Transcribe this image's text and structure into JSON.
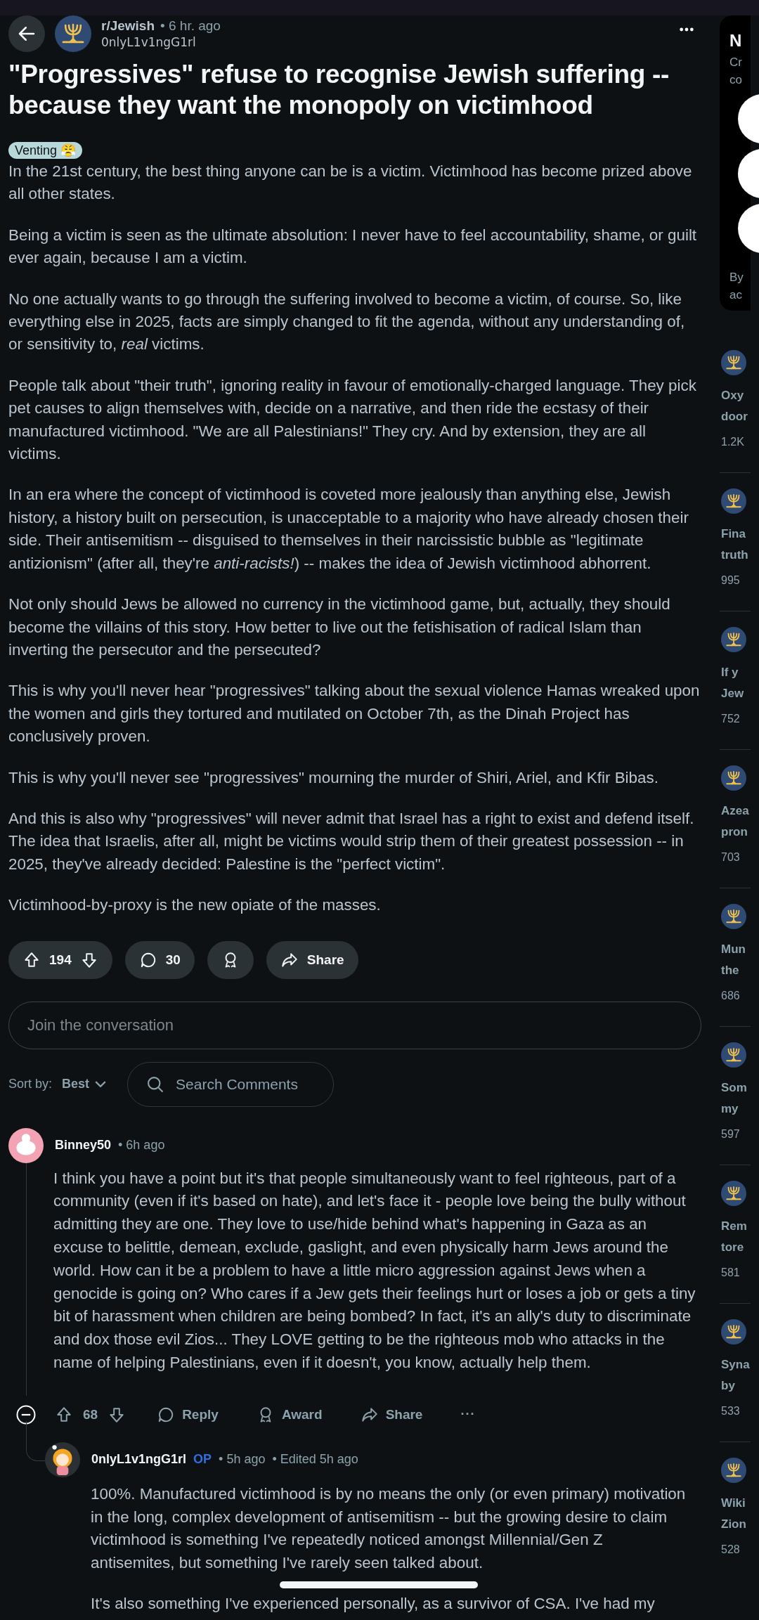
{
  "post": {
    "subreddit": "r/Jewish",
    "time": "• 6 hr. ago",
    "author": "0nlyL1v1ngG1rl",
    "title": "\"Progressives\" refuse to recognise Jewish suffering -- because they want the monopoly on victimhood",
    "flair": "Venting 😤",
    "paragraphs": [
      "In the 21st century, the best thing anyone can be is a victim. Victimhood has become prized above all other states.",
      "Being a victim is seen as the ultimate absolution: I never have to feel accountability, shame, or guilt ever again, because I am a victim.",
      "No one actually wants to go through the suffering involved to become a victim, of course. So, like everything else in 2025, facts are simply changed to fit the agenda, without any understanding of, or sensitivity to, *real* victims.",
      "People talk about \"their truth\", ignoring reality in favour of emotionally-charged language. They pick pet causes to align themselves with, decide on a narrative, and then ride the ecstasy of their manufactured victimhood. \"We are all Palestinians!\" They cry. And by extension, they are all victims.",
      "In an era where the concept of victimhood is coveted more jealously than anything else, Jewish history, a history built on persecution, is unacceptable to a majority who have already chosen their side. Their antisemitism -- disguised to themselves in their narcissistic bubble as \"legitimate antizionism\" (after all, they're *anti-racists!*) -- makes the idea of Jewish victimhood abhorrent.",
      "Not only should Jews be allowed no currency in the victimhood game, but, actually, they should become the villains of this story. How better to live out the fetishisation of radical Islam than inverting the persecutor and the persecuted?",
      "This is why you'll never hear \"progressives\" talking about the sexual violence Hamas wreaked upon the women and girls they tortured and mutilated on October 7th, as the Dinah Project has conclusively proven.",
      "This is why you'll never see \"progressives\" mourning the murder of Shiri, Ariel, and Kfir Bibas.",
      "And this is also why \"progressives\" will never admit that Israel has a right to exist and defend itself. The idea that Israelis, after all, might be victims would strip them of their greatest possession -- in 2025, they've already decided: Palestine is the \"perfect victim\".",
      "Victimhood-by-proxy is the new opiate of the masses."
    ],
    "votes": "194",
    "comment_count": "30",
    "share": "Share"
  },
  "comment_box": {
    "placeholder": "Join the conversation"
  },
  "sort": {
    "label": "Sort by:",
    "value": "Best"
  },
  "search": {
    "placeholder": "Search Comments"
  },
  "comments": [
    {
      "author": "Binney50",
      "time": "• 6h ago",
      "paragraphs": [
        "I think you have a point but it's that people simultaneously want to feel righteous, part of a community (even if it's based on hate), and let's face it - people love being the bully without admitting they are one. They love to use/hide behind what's happening in Gaza as an excuse to belittle, demean, exclude, gaslight, and even physically harm Jews around the world. How can it be a problem to have a little micro aggression against Jews when a genocide is going on? Who cares if a Jew gets their feelings hurt or loses a job or gets a tiny bit of harassment when children are being bombed? In fact, it's an ally's duty to discriminate and dox those evil Zios... They LOVE getting to be the righteous mob who attacks in the name of helping Palestinians, even if it doesn't, you know, actually help them."
      ],
      "actions": {
        "votes": "68",
        "reply": "Reply",
        "award": "Award",
        "share": "Share",
        "more": "···"
      },
      "replies": [
        {
          "author": "0nlyL1v1ngG1rl",
          "badge": "OP",
          "time": "• 5h ago",
          "edited": "• Edited 5h ago",
          "paragraphs": [
            "100%. Manufactured victimhood is by no means the only (or even primary) motivation in the long, complex development of antisemitism -- but the growing desire to claim victimhood is something I've repeatedly noticed amongst Millennial/Gen Z antisemites, but something I've rarely seen talked about.",
            "It's also something I've experienced personally, as a survivor of CSA. I've had my"
          ]
        }
      ]
    }
  ],
  "sidebar": {
    "card": {
      "title": "N",
      "lines": [
        "Cr",
        "co"
      ],
      "footer_lines": [
        "By",
        "ac"
      ]
    },
    "related": [
      {
        "title_lines": [
          "Oxy",
          "door"
        ],
        "meta": "1.2K"
      },
      {
        "title_lines": [
          "Fina",
          "truth"
        ],
        "meta": "995"
      },
      {
        "title_lines": [
          "If y",
          "Jew"
        ],
        "meta": "752"
      },
      {
        "title_lines": [
          "Azea",
          "pron"
        ],
        "meta": "703"
      },
      {
        "title_lines": [
          "Mun",
          "the"
        ],
        "meta": "686"
      },
      {
        "title_lines": [
          "Som",
          "my"
        ],
        "meta": "597"
      },
      {
        "title_lines": [
          "Rem",
          "tore"
        ],
        "meta": "581"
      },
      {
        "title_lines": [
          "Syna",
          "by"
        ],
        "meta": "533"
      },
      {
        "title_lines": [
          "Wiki",
          "Zion"
        ],
        "meta": "528"
      }
    ]
  }
}
